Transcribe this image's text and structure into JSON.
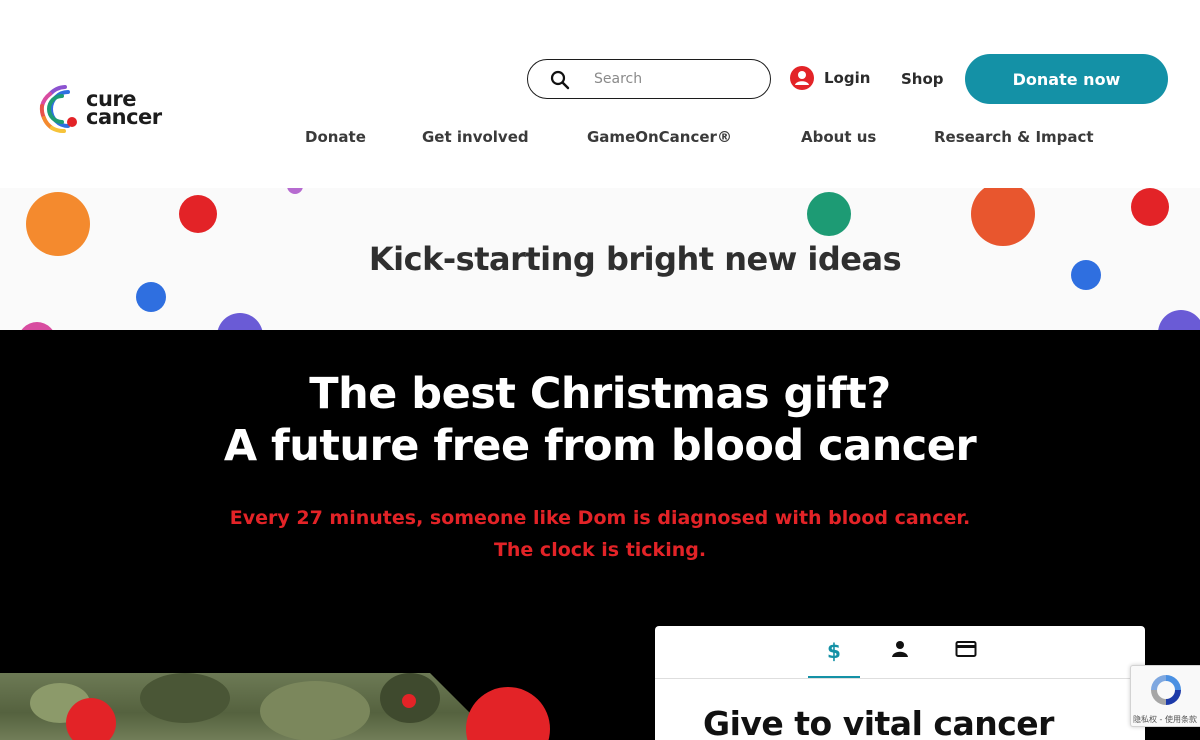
{
  "brand": {
    "logo_line1": "cure",
    "logo_line2": "cancer"
  },
  "header": {
    "search_placeholder": "Search",
    "login_label": "Login",
    "shop_label": "Shop",
    "donate_label": "Donate now"
  },
  "nav": {
    "items": [
      {
        "label": "Donate"
      },
      {
        "label": "Get involved"
      },
      {
        "label": "GameOnCancer®"
      },
      {
        "label": "About us"
      },
      {
        "label": "Research & Impact"
      }
    ]
  },
  "strip": {
    "title": "Kick-starting bright new ideas"
  },
  "promo": {
    "headline_line1": "The best Christmas gift?",
    "headline_line2": "A future free from blood cancer",
    "sub_line1": "Every 27 minutes, someone like Dom is diagnosed with blood cancer.",
    "sub_line2": "The clock is ticking."
  },
  "donation_form": {
    "tabs": [
      {
        "icon": "dollar-icon",
        "label": "$"
      },
      {
        "icon": "person-icon"
      },
      {
        "icon": "credit-card-icon"
      }
    ],
    "title": "Give to vital cancer"
  },
  "recaptcha": {
    "footer": "隐私权 - 使用条款"
  },
  "colors": {
    "accent": "#1491a6",
    "alert_red": "#e32327",
    "dark_bg": "#000000"
  }
}
